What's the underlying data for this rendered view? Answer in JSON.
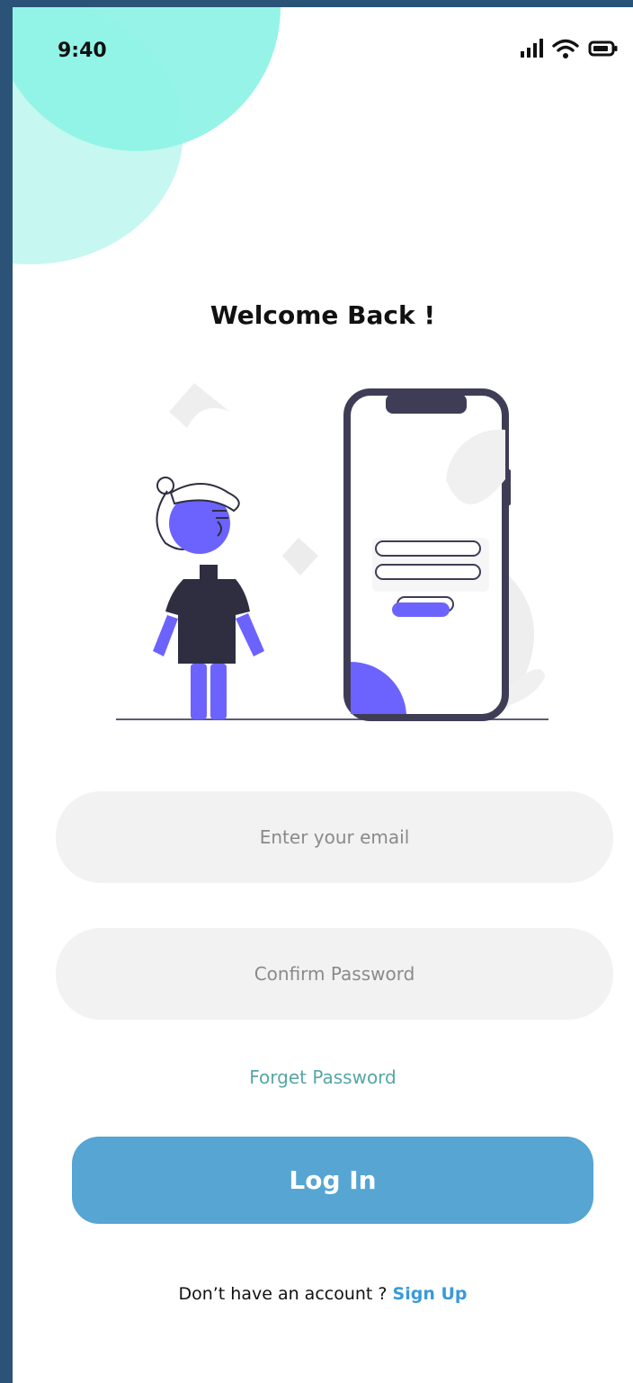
{
  "status": {
    "time": "9:40"
  },
  "header": {
    "title": "Welcome Back !"
  },
  "form": {
    "email_placeholder": "Enter your email",
    "password_placeholder": "Confirm Password",
    "forgot_label": "Forget Password",
    "login_label": "Log In"
  },
  "footer": {
    "prompt": "Don’t have an account ? ",
    "signup_label": "Sign Up"
  },
  "colors": {
    "accent_blue": "#56a5d2",
    "link_teal": "#55a7a5",
    "illustration_purple": "#6c63ff",
    "blob_teal": "#8ff3e6"
  }
}
